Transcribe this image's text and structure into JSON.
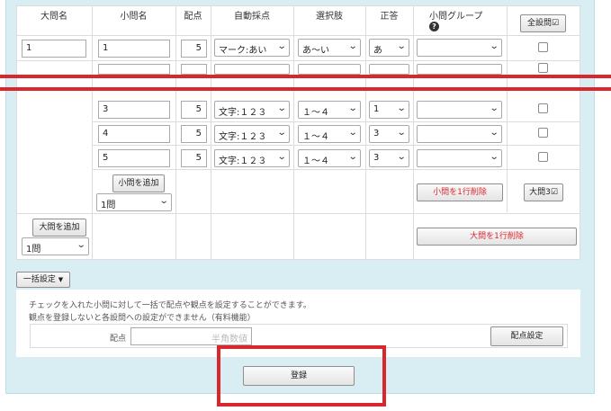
{
  "headers": {
    "daimon": "大問名",
    "shomon": "小問名",
    "haiten": "配点",
    "jidou": "自動採点",
    "sentakushi": "選択肢",
    "seitou": "正答",
    "group": "小問グループ",
    "help_icon": "?"
  },
  "all_check_button": "全設問☑",
  "rows": [
    {
      "daimon": "1",
      "shomon": "1",
      "score": "5",
      "auto": "マーク:あい",
      "choice": "あ〜い",
      "answer": "あ",
      "checked": false
    },
    {
      "daimon": "",
      "shomon": "",
      "score": "",
      "auto": "",
      "choice": "",
      "answer": "",
      "checked": false
    },
    {
      "daimon": "",
      "shomon": "3",
      "score": "5",
      "auto": "文字:１２３",
      "choice": "１〜４",
      "answer": "1",
      "checked": false
    },
    {
      "daimon": "",
      "shomon": "4",
      "score": "5",
      "auto": "文字:１２３",
      "choice": "１〜４",
      "answer": "3",
      "checked": false
    },
    {
      "daimon": "",
      "shomon": "5",
      "score": "5",
      "auto": "文字:１２３",
      "choice": "１〜４",
      "answer": "3",
      "checked": false
    }
  ],
  "add_shomon": {
    "button": "小問を追加",
    "count": "1問"
  },
  "delete_shomon_row": "小問を1行削除",
  "daimon3_button": "大問3☑",
  "add_daimon": {
    "button": "大問を追加",
    "count": "1問"
  },
  "delete_daimon_row": "大問を1行削除",
  "bulk": {
    "toggle": "一括設定",
    "desc_line1": "チェックを入れた小問に対して一括で配点や観点を設定することができます。",
    "desc_line2": "観点を登録しないと各設問への設定ができません（有料機能）",
    "score_label": "配点",
    "score_placeholder": "半角数値",
    "score_button": "配点設定"
  },
  "register_button": "登録",
  "colors": {
    "accent_red": "#d9272e",
    "panel_bg": "#d8eef3"
  }
}
